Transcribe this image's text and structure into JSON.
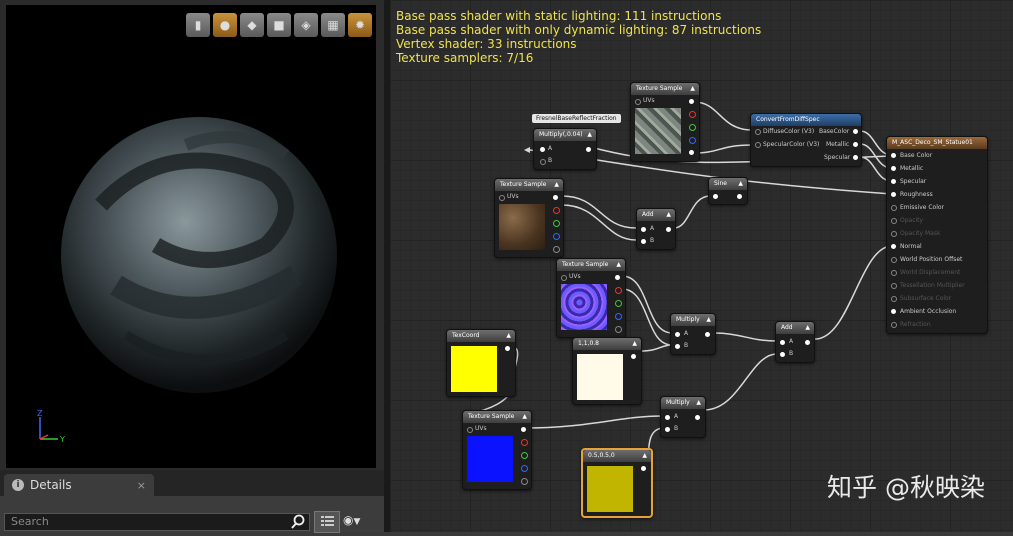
{
  "stats": {
    "line1": "Base pass shader with static lighting: 111 instructions",
    "line2": "Base pass shader with only dynamic lighting: 87 instructions",
    "line3": "Vertex shader: 33 instructions",
    "line4": "Texture samplers: 7/16"
  },
  "viewport": {
    "axis_z": "Z",
    "axis_y": "Y",
    "toolbar_icons": [
      "cylinder-icon",
      "sphere-icon",
      "plane-icon",
      "cube-icon",
      "mesh-icon",
      "grid-icon",
      "realtime-icon"
    ]
  },
  "details": {
    "tab_label": "Details",
    "tab_close": "×",
    "search_placeholder": "Search"
  },
  "nodes": {
    "fresnel_label": "FresnelBaseReflectFraction",
    "multiply_004": {
      "title": "Multiply(,0.04)",
      "pin_a": "A",
      "pin_b": "B"
    },
    "tex1": {
      "title": "Texture Sample",
      "uvs": "UVs"
    },
    "convert": {
      "title": "ConvertFromDiffSpec",
      "in1": "DiffuseColor (V3)",
      "in2": "SpecularColor (V3)",
      "out1": "BaseColor",
      "out2": "Metallic",
      "out3": "Specular"
    },
    "result": {
      "title": "M_ASC_Deco_SM_Statue01",
      "pins": [
        "Base Color",
        "Metallic",
        "Specular",
        "Roughness",
        "Emissive Color",
        "Opacity",
        "Opacity Mask",
        "Normal",
        "World Position Offset",
        "World Displacement",
        "Tessellation Multiplier",
        "Subsurface Color",
        "Ambient Occlusion",
        "Refraction"
      ]
    },
    "tex2": {
      "title": "Texture Sample",
      "uvs": "UVs"
    },
    "sine": {
      "title": "Sine"
    },
    "add1": {
      "title": "Add",
      "pin_a": "A",
      "pin_b": "B"
    },
    "tex3": {
      "title": "Texture Sample",
      "uvs": "UVs"
    },
    "multiply1": {
      "title": "Multiply",
      "pin_a": "A",
      "pin_b": "B"
    },
    "add2": {
      "title": "Add",
      "pin_a": "A",
      "pin_b": "B"
    },
    "texcoord": {
      "title": "TexCoord"
    },
    "const3": {
      "title": "1,1,0.8"
    },
    "multiply2": {
      "title": "Multiply",
      "pin_a": "A",
      "pin_b": "B"
    },
    "tex4": {
      "title": "Texture Sample",
      "uvs": "UVs"
    },
    "const2": {
      "title": "0.5,0.5,0"
    },
    "collapse_glyph": "▲"
  },
  "watermark": "知乎 @秋映染",
  "colors": {
    "stats_text": "#f0e24e",
    "selected_border": "#e8a23a",
    "wire": "#d8d8d8"
  }
}
